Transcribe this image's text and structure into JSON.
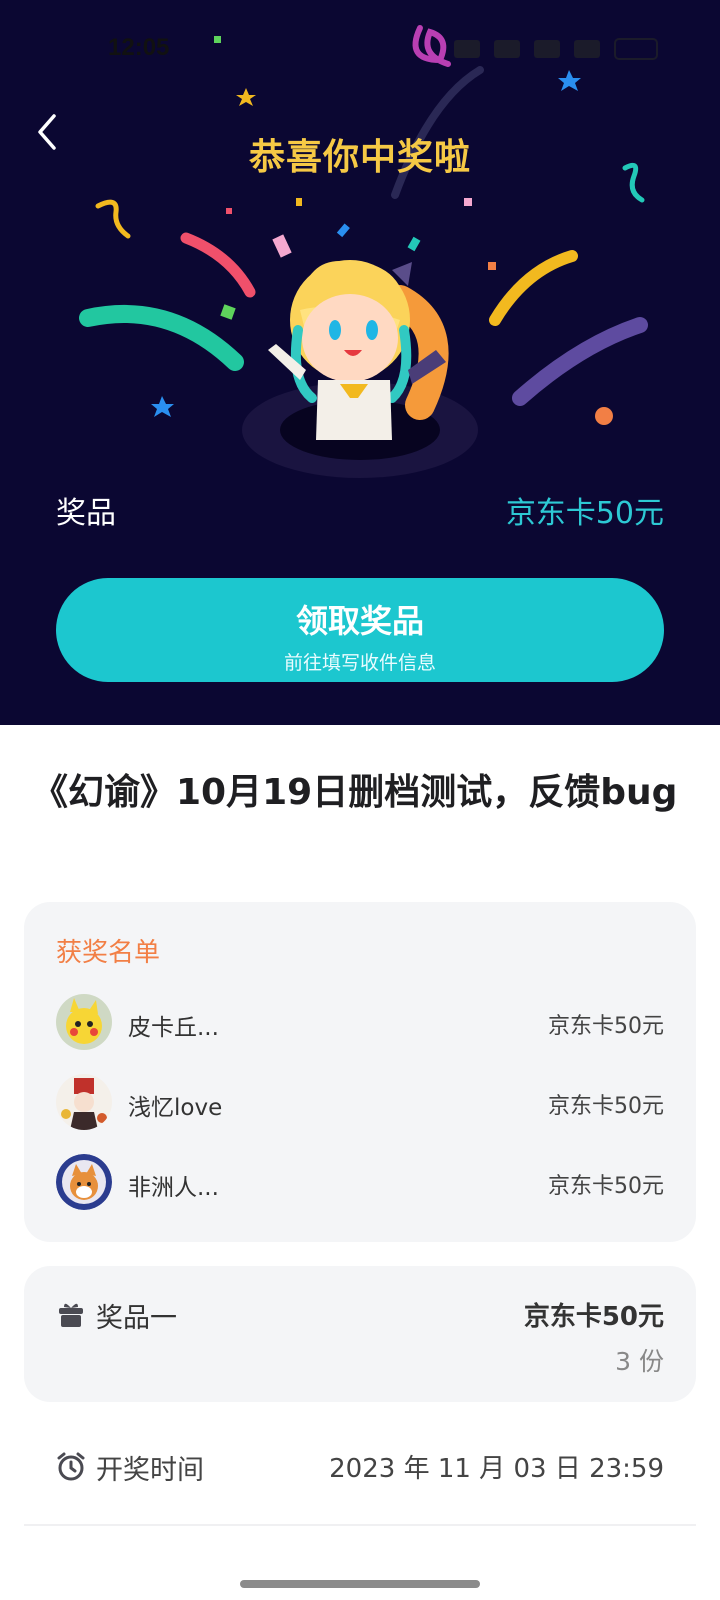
{
  "status_bar": {
    "time": "12:05"
  },
  "header": {
    "title": "恭喜你中奖啦"
  },
  "prize": {
    "label": "奖品",
    "value": "京东卡50元"
  },
  "claim_button": {
    "label": "领取奖品",
    "sublabel": "前往填写收件信息"
  },
  "event": {
    "title": "《幻谕》10月19日删档测试，反馈bug"
  },
  "winners": {
    "heading": "获奖名单",
    "items": [
      {
        "name": "皮卡丘...",
        "prize": "京东卡50元"
      },
      {
        "name": "浅忆love",
        "prize": "京东卡50元"
      },
      {
        "name": "非洲人...",
        "prize": "京东卡50元"
      }
    ]
  },
  "prize_detail": {
    "label": "奖品一",
    "value": "京东卡50元",
    "quantity": "3 份"
  },
  "draw_time": {
    "label": "开奖时间",
    "value": "2023 年 11 月 03 日 23:59"
  },
  "colors": {
    "hero_bg": "#0b0732",
    "accent": "#1cc7cf",
    "title": "#f6c945",
    "winner_heading": "#f27f45"
  }
}
